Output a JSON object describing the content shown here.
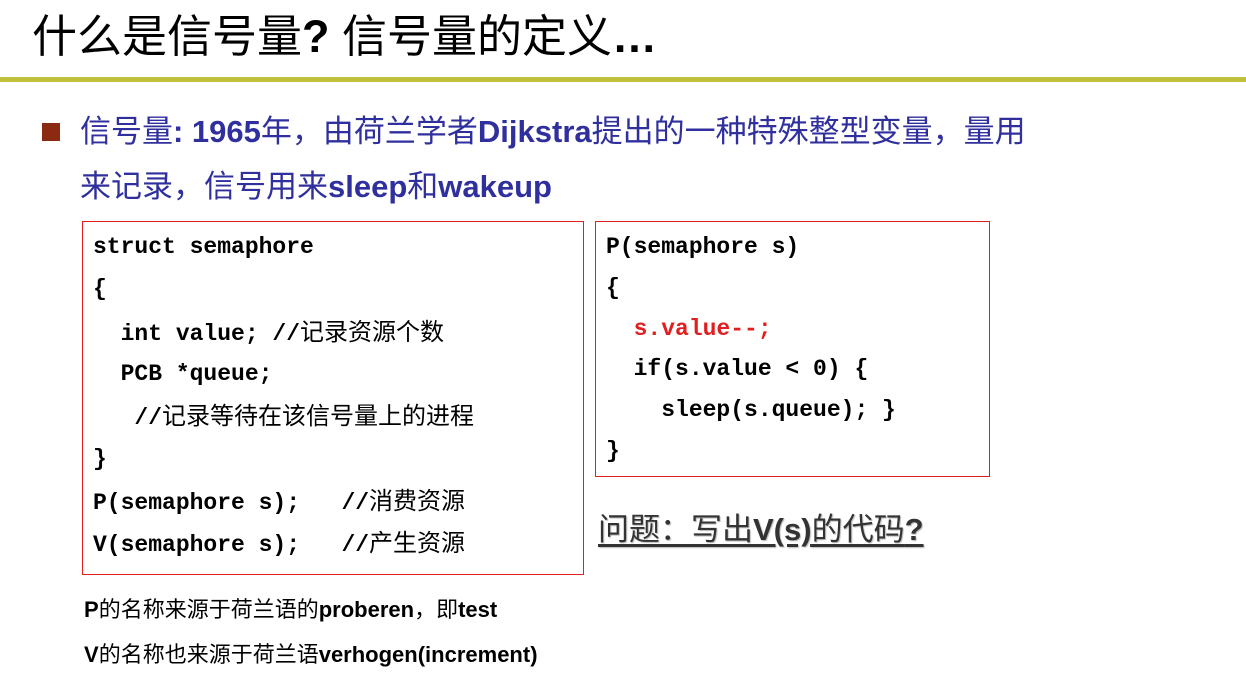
{
  "slide": {
    "title_part1": "什么是信号量",
    "title_qmark": "?",
    "title_part2": " 信号量的定义",
    "title_ellipsis": "…"
  },
  "bullet": {
    "line1": [
      {
        "t": "信号量",
        "b": false
      },
      {
        "t": ": 1965",
        "b": true
      },
      {
        "t": "年，由荷兰学者",
        "b": false
      },
      {
        "t": "Dijkstra",
        "b": true
      },
      {
        "t": "提出的一种特殊整型变量，量用",
        "b": false
      }
    ],
    "line2": [
      {
        "t": "来记录，信号用来",
        "b": false
      },
      {
        "t": "sleep",
        "b": true
      },
      {
        "t": "和",
        "b": false
      },
      {
        "t": "wakeup",
        "b": true
      }
    ]
  },
  "struct_code": [
    {
      "code": "struct semaphore",
      "comment": ""
    },
    {
      "code": "{",
      "comment": ""
    },
    {
      "code": "  int value; //",
      "comment": "记录资源个数"
    },
    {
      "code": "  PCB *queue;",
      "comment": ""
    },
    {
      "code": "   //",
      "comment": "记录等待在该信号量上的进程"
    },
    {
      "code": "}",
      "comment": ""
    },
    {
      "code": "P(semaphore s);   //",
      "comment": "消费资源"
    },
    {
      "code": "V(semaphore s);   //",
      "comment": "产生资源"
    }
  ],
  "p_code": [
    {
      "code": "P(semaphore s)",
      "comment": ""
    },
    {
      "code": "{",
      "comment": ""
    },
    {
      "code": "  s.value--;",
      "comment": "",
      "highlight": true
    },
    {
      "code": "  if(s.value < 0) {",
      "comment": ""
    },
    {
      "code": "    sleep(s.queue); }",
      "comment": ""
    },
    {
      "code": "}",
      "comment": ""
    }
  ],
  "question": {
    "part1": "问题：写出",
    "part2": "V(s)",
    "part3": "的代码",
    "part4": "?"
  },
  "notes": {
    "line1": [
      {
        "t": "P",
        "b": true
      },
      {
        "t": "的名称来源于荷兰语的",
        "b": false
      },
      {
        "t": "proberen",
        "b": true
      },
      {
        "t": "，即",
        "b": false
      },
      {
        "t": "test",
        "b": true
      }
    ],
    "line2": [
      {
        "t": "V",
        "b": true
      },
      {
        "t": "的名称也来源于荷兰语",
        "b": false
      },
      {
        "t": "verhogen(increment)",
        "b": true
      }
    ]
  },
  "colors": {
    "title_text": "#000000",
    "rule": "#c0c03a",
    "bullet_square": "#8b2a10",
    "bullet_text": "#2f2f9e",
    "box_border": "#e02020",
    "highlight_code": "#e02020",
    "question_text": "#333333"
  }
}
